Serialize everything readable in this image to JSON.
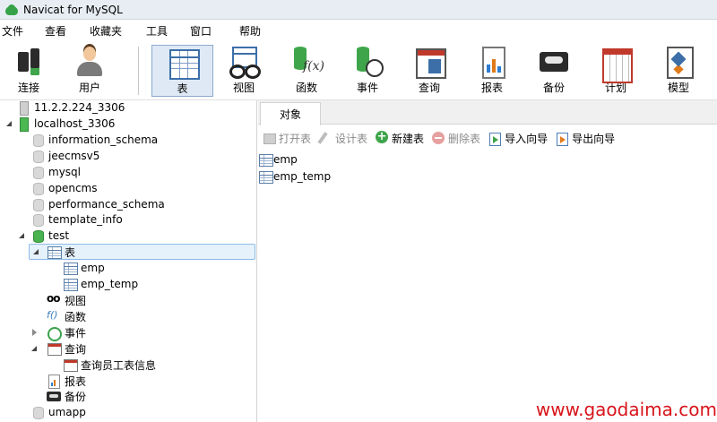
{
  "window": {
    "title": "Navicat for MySQL"
  },
  "menu": [
    "文件",
    "查看",
    "收藏夹",
    "工具",
    "窗口",
    "帮助"
  ],
  "toolbar": [
    {
      "label": "连接",
      "icon": "connection-icon"
    },
    {
      "label": "用户",
      "icon": "user-icon"
    },
    {
      "label": "表",
      "icon": "table-icon",
      "active": true
    },
    {
      "label": "视图",
      "icon": "view-icon"
    },
    {
      "label": "函数",
      "icon": "function-icon"
    },
    {
      "label": "事件",
      "icon": "event-icon"
    },
    {
      "label": "查询",
      "icon": "query-icon"
    },
    {
      "label": "报表",
      "icon": "report-icon"
    },
    {
      "label": "备份",
      "icon": "backup-icon"
    },
    {
      "label": "计划",
      "icon": "schedule-icon"
    },
    {
      "label": "模型",
      "icon": "model-icon"
    }
  ],
  "tree": [
    {
      "label": "11.2.2.224_3306",
      "icon": "server-icon"
    },
    {
      "label": "localhost_3306",
      "icon": "server-icon",
      "expanded": true
    },
    {
      "label": "information_schema",
      "icon": "database-icon"
    },
    {
      "label": "jeecmsv5",
      "icon": "database-icon"
    },
    {
      "label": "mysql",
      "icon": "database-icon"
    },
    {
      "label": "opencms",
      "icon": "database-icon"
    },
    {
      "label": "performance_schema",
      "icon": "database-icon"
    },
    {
      "label": "template_info",
      "icon": "database-icon"
    },
    {
      "label": "test",
      "icon": "database-icon",
      "expanded": true
    },
    {
      "label": "表",
      "icon": "table-icon",
      "expanded": true,
      "selected": true
    },
    {
      "label": "emp",
      "icon": "table-icon"
    },
    {
      "label": "emp_temp",
      "icon": "table-icon"
    },
    {
      "label": "视图",
      "icon": "view-icon"
    },
    {
      "label": "函数",
      "icon": "function-icon"
    },
    {
      "label": "事件",
      "icon": "event-icon",
      "collapsed": true
    },
    {
      "label": "查询",
      "icon": "query-icon",
      "expanded": true
    },
    {
      "label": "查询员工表信息",
      "icon": "query-icon"
    },
    {
      "label": "报表",
      "icon": "report-icon"
    },
    {
      "label": "备份",
      "icon": "backup-icon"
    },
    {
      "label": "umapp",
      "icon": "database-icon"
    }
  ],
  "tabs": {
    "objects": "对象"
  },
  "object_toolbar": [
    {
      "label": "打开表",
      "icon": "open-table-icon",
      "enabled": false
    },
    {
      "label": "设计表",
      "icon": "design-table-icon",
      "enabled": false
    },
    {
      "label": "新建表",
      "icon": "new-table-icon",
      "enabled": true
    },
    {
      "label": "删除表",
      "icon": "delete-table-icon",
      "enabled": false
    },
    {
      "label": "导入向导",
      "icon": "import-wizard-icon",
      "enabled": true
    },
    {
      "label": "导出向导",
      "icon": "export-wizard-icon",
      "enabled": true
    }
  ],
  "objects": [
    "emp",
    "emp_temp"
  ],
  "watermark": "www.gaodaima.com"
}
